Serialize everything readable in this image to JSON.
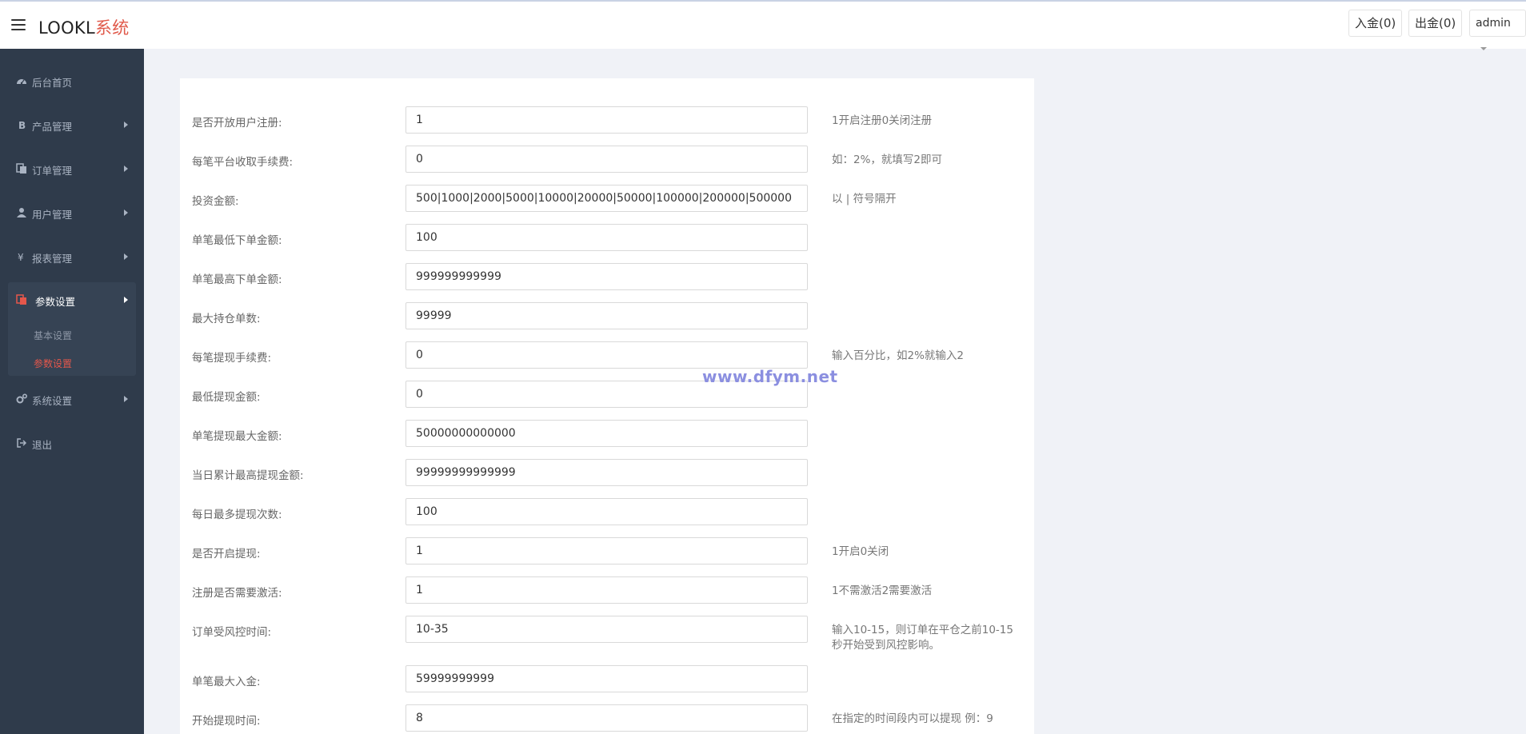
{
  "brand": {
    "main": "LOOKL",
    "accent": "系统"
  },
  "header": {
    "deposit_label": "入金(0)",
    "withdraw_label": "出金(0)",
    "user_label": "admin"
  },
  "sidebar": {
    "items": [
      {
        "label": "后台首页",
        "icon": "dashboard-icon"
      },
      {
        "label": "产品管理",
        "icon": "bitcoin-icon"
      },
      {
        "label": "订单管理",
        "icon": "copy-icon"
      },
      {
        "label": "用户管理",
        "icon": "user-icon"
      },
      {
        "label": "报表管理",
        "icon": "yen-icon"
      },
      {
        "label": "参数设置",
        "icon": "files-icon",
        "expanded": true
      },
      {
        "label": "系统设置",
        "icon": "cogs-icon"
      },
      {
        "label": "退出",
        "icon": "sign-out-icon"
      }
    ],
    "subitems": [
      {
        "label": "基本设置"
      },
      {
        "label": "参数设置",
        "active": true
      }
    ]
  },
  "form": {
    "rows": [
      {
        "label": "是否开放用户注册:",
        "value": "1",
        "hint": "1开启注册0关闭注册"
      },
      {
        "label": "每笔平台收取手续费:",
        "value": "0",
        "hint": "如：2%，就填写2即可"
      },
      {
        "label": "投资金额:",
        "value": "500|1000|2000|5000|10000|20000|50000|100000|200000|500000",
        "hint": "以 | 符号隔开"
      },
      {
        "label": "单笔最低下单金额:",
        "value": "100",
        "hint": ""
      },
      {
        "label": "单笔最高下单金额:",
        "value": "999999999999",
        "hint": ""
      },
      {
        "label": "最大持仓单数:",
        "value": "99999",
        "hint": ""
      },
      {
        "label": "每笔提现手续费:",
        "value": "0",
        "hint": "输入百分比，如2%就输入2"
      },
      {
        "label": "最低提现金额:",
        "value": "0",
        "hint": ""
      },
      {
        "label": "单笔提现最大金额:",
        "value": "50000000000000",
        "hint": ""
      },
      {
        "label": "当日累计最高提现金额:",
        "value": "99999999999999",
        "hint": ""
      },
      {
        "label": "每日最多提现次数:",
        "value": "100",
        "hint": ""
      },
      {
        "label": "是否开启提现:",
        "value": "1",
        "hint": "1开启0关闭"
      },
      {
        "label": "注册是否需要激活:",
        "value": "1",
        "hint": "1不需激活2需要激活"
      },
      {
        "label": "订单受风控时间:",
        "value": "10-35",
        "hint": "输入10-15，则订单在平仓之前10-15秒开始受到风控影响。"
      },
      {
        "label": "单笔最大入金:",
        "value": "59999999999",
        "hint": ""
      },
      {
        "label": "开始提现时间:",
        "value": "8",
        "hint": "在指定的时间段内可以提现 例：9"
      }
    ]
  },
  "watermark": "www.dfym.net",
  "colors": {
    "sidebar_bg": "#2f3b4b",
    "accent": "#e5574b",
    "page_bg": "#f0f2f7"
  }
}
